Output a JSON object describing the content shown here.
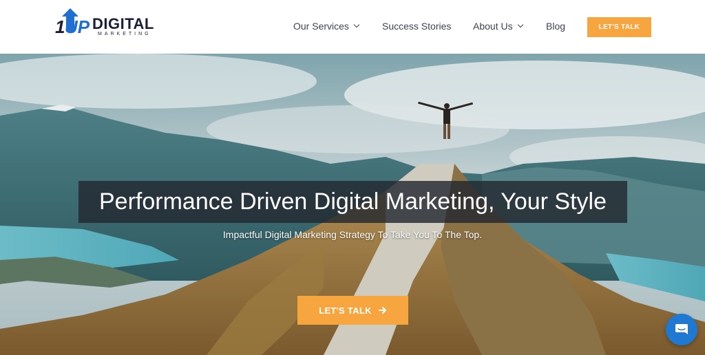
{
  "header": {
    "logo_digital": "DIGITAL",
    "logo_marketing": "MARKETING",
    "logo_mark_text": "1UP",
    "nav": [
      {
        "label": "Our Services",
        "has_dropdown": true
      },
      {
        "label": "Success Stories",
        "has_dropdown": false
      },
      {
        "label": "About Us",
        "has_dropdown": true
      },
      {
        "label": "Blog",
        "has_dropdown": false
      }
    ],
    "cta_label": "LET'S TALK"
  },
  "hero": {
    "headline": "Performance Driven Digital Marketing, Your Style",
    "subheadline": "Impactful Digital Marketing Strategy To Take You To The Top.",
    "cta_label": "LET'S TALK",
    "cta_icon": "arrow-right-icon"
  },
  "chat_widget": {
    "icon": "chat-bubble-icon"
  },
  "colors": {
    "accent": "#f6a53f",
    "logo_blue": "#1f6fd1",
    "logo_dark": "#1a1f36",
    "chat_blue": "#1f78d1"
  }
}
